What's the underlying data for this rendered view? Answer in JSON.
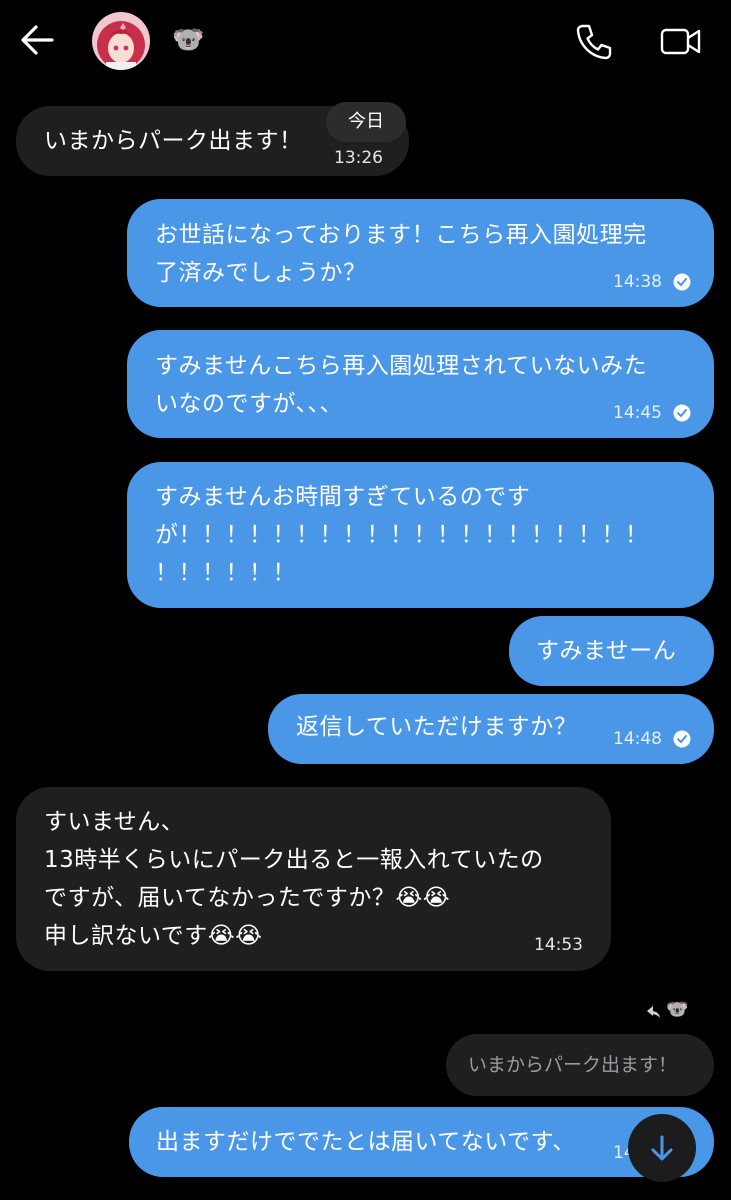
{
  "header": {
    "contact_name": "🐨",
    "back_icon": "arrow-left-icon",
    "call_icon": "phone-icon",
    "video_icon": "video-camera-icon"
  },
  "date_separator": "今日",
  "messages": [
    {
      "side": "in",
      "text": "いまからパーク出ます！",
      "time": "13:26"
    },
    {
      "side": "out",
      "text": "お世話になっております！こちら再入園処理完\n了済みでしょうか？",
      "time": "14:38",
      "read": true
    },
    {
      "side": "out",
      "text": "すみませんこちら再入園処理されていないみた\nいなのですが、、、",
      "time": "14:45",
      "read": true
    },
    {
      "side": "out",
      "text": "すみませんお時間すぎているのです\nが！！！！！！！！！！！！！！！！！！！！\n！！！！！！",
      "time": "",
      "read": false
    },
    {
      "side": "out",
      "text": "すみませーん",
      "time": "",
      "read": false
    },
    {
      "side": "out",
      "text": "返信していただけますか？",
      "time": "14:48",
      "read": true
    },
    {
      "side": "in",
      "text": "すいません、\n13時半くらいにパーク出ると一報入れていたの\nですが、届いてなかったですか？😭😭\n申し訳ないです😭😭",
      "time": "14:53"
    },
    {
      "side": "out",
      "text": "出ますだけででたとは届いてないです、",
      "time": "14",
      "read": false
    }
  ],
  "reply": {
    "reply_icon": "reply-arrow-icon",
    "replied_to_name": "🐨",
    "quoted_text": "いまからパーク出ます！"
  },
  "scroll_button_icon": "arrow-down-icon",
  "colors": {
    "background": "#000000",
    "incoming_bubble": "#1f1f21",
    "outgoing_bubble": "#4a97e8"
  }
}
